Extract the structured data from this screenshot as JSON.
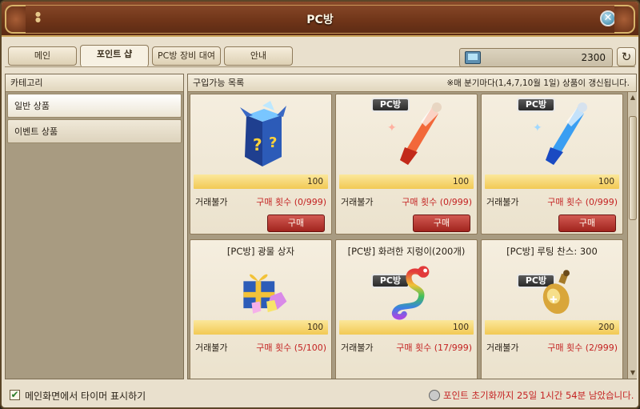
{
  "window": {
    "title": "PC방",
    "close_icon": "close-icon"
  },
  "tabs": [
    {
      "label": "메인"
    },
    {
      "label": "포인트 샵"
    },
    {
      "label": "PC방 장비 대여"
    },
    {
      "label": "안내"
    }
  ],
  "points": {
    "value": "2300",
    "icon": "pc-icon"
  },
  "category_panel": {
    "header": "카테고리",
    "items": [
      {
        "label": "일반 상품"
      },
      {
        "label": "이벤트 상품"
      }
    ]
  },
  "shop": {
    "header": "구입가능 목록",
    "notice": "※매 분기마다(1,4,7,10월 1일) 상품이 갱신됩니다.",
    "items": [
      {
        "name": "",
        "badge": "",
        "price": "100",
        "trade": "거래불가",
        "limit": "구매 횟수 (0/999)",
        "buy": "구매"
      },
      {
        "name": "",
        "badge": "PC방",
        "price": "100",
        "trade": "거래불가",
        "limit": "구매 횟수 (0/999)",
        "buy": "구매"
      },
      {
        "name": "",
        "badge": "PC방",
        "price": "100",
        "trade": "거래불가",
        "limit": "구매 횟수 (0/999)",
        "buy": "구매"
      },
      {
        "name": "[PC방] 광물 상자",
        "badge": "",
        "price": "100",
        "trade": "거래불가",
        "limit": "구매 횟수 (5/100)"
      },
      {
        "name": "[PC방] 화려한 지렁이(200개)",
        "badge": "PC방",
        "price": "100",
        "trade": "거래불가",
        "limit": "구매 횟수 (17/999)"
      },
      {
        "name": "[PC방] 루팅 찬스: 300",
        "badge": "PC방",
        "price": "200",
        "trade": "거래불가",
        "limit": "구매 횟수 (2/999)"
      }
    ]
  },
  "footer": {
    "checkbox_label": "메인화면에서 타이머 표시하기",
    "checked": true,
    "timer_text": "포인트 초기화까지 25일 1시간 54분 남았습니다."
  },
  "colors": {
    "accent": "#c42222",
    "title_bar": "#6e3418",
    "price_bar": "#f2c954"
  }
}
